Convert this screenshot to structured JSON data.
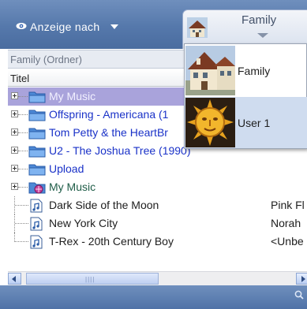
{
  "toolbar": {
    "view_by_label": "Anzeige nach",
    "profile_name": "Family"
  },
  "breadcrumb": "Family (Ordner)",
  "column_header": "Titel",
  "tree": [
    {
      "label": "My Music",
      "type": "folder",
      "selected": true
    },
    {
      "label": "Offspring - Americana (1",
      "type": "folder"
    },
    {
      "label": "Tom Petty & the HeartBr",
      "type": "folder"
    },
    {
      "label": "U2 - The Joshua Tree (1990)",
      "type": "folder"
    },
    {
      "label": "Upload",
      "type": "folder"
    },
    {
      "label": "My Music",
      "type": "network-folder"
    },
    {
      "label": "Dark Side of the Moon",
      "type": "file",
      "artist": "Pink Fl"
    },
    {
      "label": "New York City",
      "type": "file",
      "artist": "Norah"
    },
    {
      "label": "T-Rex - 20th Century Boy",
      "type": "file",
      "artist": "<Unbe"
    }
  ],
  "scrollbar": {
    "grip": "||||"
  },
  "dropdown": {
    "items": [
      {
        "label": "Family",
        "icon": "house-photo"
      },
      {
        "label": "User 1",
        "icon": "sun-face-photo",
        "highlighted": true
      }
    ]
  },
  "colors": {
    "toolbar": "#5578ab",
    "folder_label": "#1a32c8",
    "selection": "#a9a3db",
    "dropdown_highlight": "#cfdcef"
  }
}
